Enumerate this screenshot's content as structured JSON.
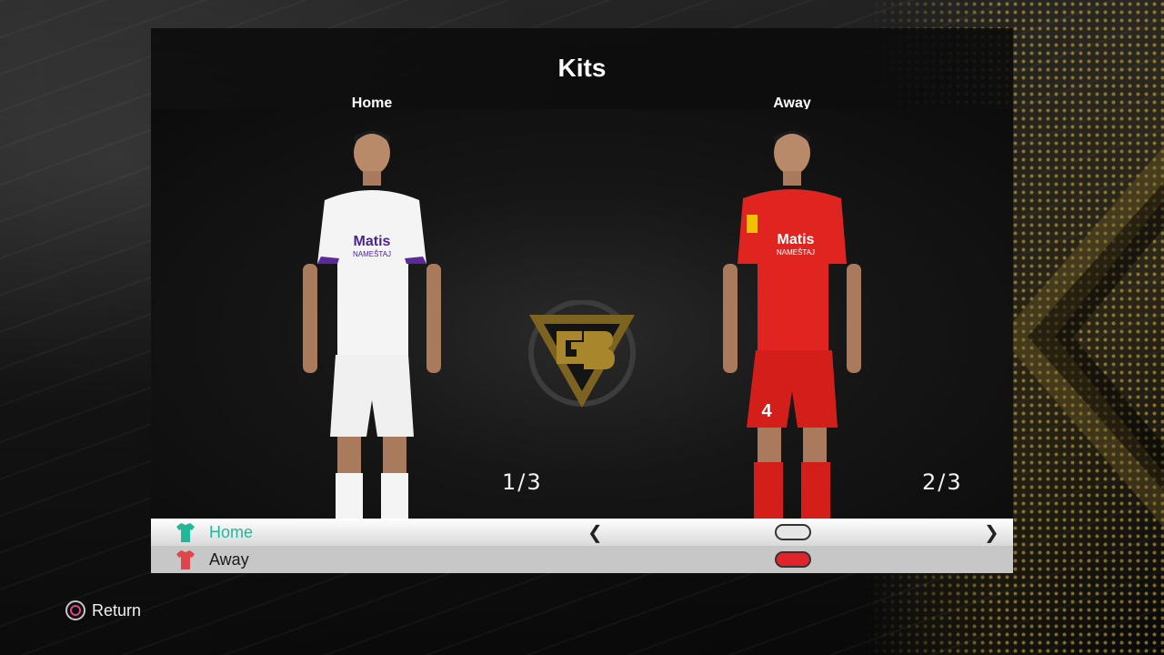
{
  "screen": {
    "title": "Kits"
  },
  "columns": {
    "home_label": "Home",
    "away_label": "Away"
  },
  "kits": {
    "home": {
      "count": "1/3",
      "shirt_color": "#ffffff",
      "trim_color": "#5a2a9c",
      "sponsor": "Matis",
      "sponsor_sub": "NAMEŠTAJ"
    },
    "away": {
      "count": "2/3",
      "shirt_color": "#e0241f",
      "trim_color": "#b8140f",
      "sponsor": "Matis",
      "sponsor_sub": "NAMEŠTAJ",
      "shorts_number": "4"
    }
  },
  "kit_list": [
    {
      "name": "Home",
      "icon": "shirt-icon",
      "icon_color": "#22b79a",
      "swatch_color": "#e6e6e6",
      "selected": true
    },
    {
      "name": "Away",
      "icon": "shirt-icon",
      "icon_color": "#e0454a",
      "swatch_color": "#e0242b",
      "selected": false
    }
  ],
  "navigation": {
    "prev_glyph": "❮",
    "next_glyph": "❯"
  },
  "footer": {
    "return_label": "Return",
    "return_button": "circle-button-icon"
  },
  "colors": {
    "accent_teal": "#22b79a",
    "gold": "#d6b64c"
  }
}
